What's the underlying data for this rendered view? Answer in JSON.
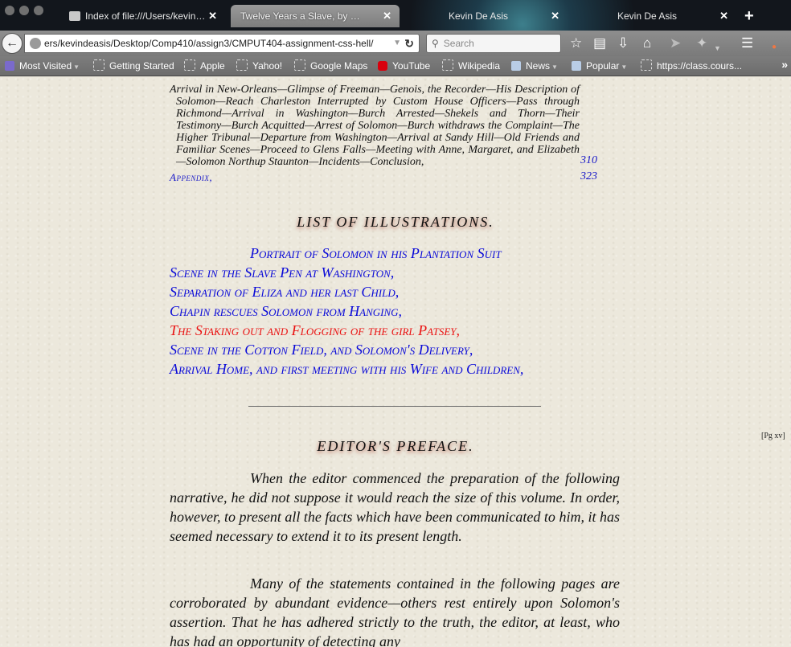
{
  "browser": {
    "tabs": [
      {
        "label": "Index of file:///Users/kevind...",
        "active": false
      },
      {
        "label": "Twelve Years a Slave, by Solom...",
        "active": true
      },
      {
        "label": "Kevin De Asis",
        "active": false
      },
      {
        "label": "Kevin De Asis",
        "active": false
      }
    ],
    "tab_close": "✕",
    "new_tab": "+",
    "url": "ers/kevindeasis/Desktop/Comp410/assign3/CMPUT404-assignment-css-hell/",
    "search_placeholder": "Search",
    "bookmarks": [
      {
        "label": "Most Visited",
        "icon": "most-visited-icon",
        "dropdown": true
      },
      {
        "label": "Getting Started",
        "icon": "page-icon"
      },
      {
        "label": "Apple",
        "icon": "page-icon"
      },
      {
        "label": "Yahoo!",
        "icon": "page-icon"
      },
      {
        "label": "Google Maps",
        "icon": "page-icon"
      },
      {
        "label": "YouTube",
        "icon": "youtube-icon"
      },
      {
        "label": "Wikipedia",
        "icon": "page-icon"
      },
      {
        "label": "News",
        "icon": "folder-icon",
        "dropdown": true
      },
      {
        "label": "Popular",
        "icon": "folder-icon",
        "dropdown": true
      },
      {
        "label": "https://class.cours...",
        "icon": "page-icon"
      }
    ],
    "bookmarks_overflow": "»"
  },
  "content": {
    "toc_entry": "Arrival in New-Orleans—Glimpse of Freeman—Genois, the Recorder—His Description of Solomon—Reach Charleston Interrupted by Custom House Officers—Pass through Richmond—Arrival in Washington—Burch Arrested—Shekels and Thorn—Their Testimony—Burch Acquitted—Arrest of Solomon—Burch withdraws the Complaint—The Higher Tribunal—Departure from Washington—Arrival at Sandy Hill—Old Friends and Familiar Scenes—Proceed to Glens Falls—Meeting with Anne, Margaret, and Elizabeth—Solomon Northup Staunton—Incidents—Conclusion,",
    "toc_entry_page": "310",
    "appendix_label": "Appendix,",
    "appendix_page": "323",
    "illustrations_heading": "LIST OF ILLUSTRATIONS.",
    "illustrations": [
      "Portrait of Solomon in his Plantation Suit",
      "Scene in the Slave Pen at Washington,",
      "Separation of Eliza and her last Child,",
      "Chapin rescues Solomon from Hanging,",
      "The Staking out and Flogging of the girl Patsey,",
      "Scene in the Cotton Field, and Solomon's Delivery,",
      "Arrival Home, and first meeting with his Wife and Children,"
    ],
    "page_marker": "[Pg xv]",
    "preface_heading": "EDITOR'S PREFACE.",
    "preface_paragraphs": [
      "When the editor commenced the preparation of the following narrative, he did not suppose it would reach the size of this volume. In order, however, to present all the facts which have been communicated to him, it has seemed necessary to extend it to its present length.",
      "Many of the statements contained in the following pages are corroborated by abundant evidence—others rest entirely upon Solomon's assertion. That he has adhered strictly to the truth, the editor, at least, who has had an opportunity of detecting any"
    ]
  },
  "colors": {
    "link_blue": "#0a0ad8",
    "hover_red": "#ea1111",
    "page_background": "#ece8dc"
  }
}
